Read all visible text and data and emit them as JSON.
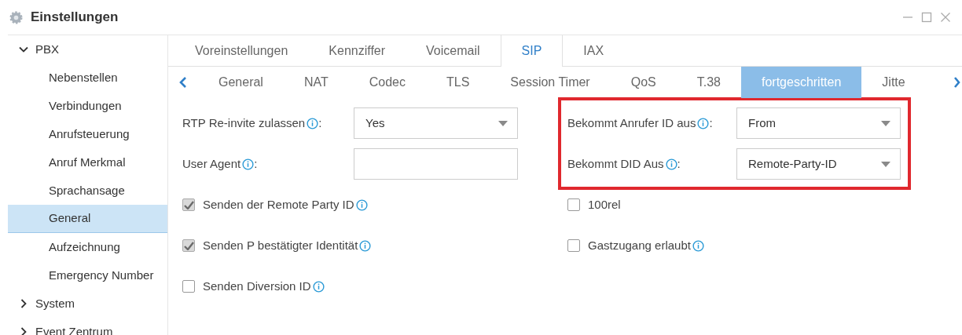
{
  "window": {
    "title": "Einstellungen"
  },
  "sidebar": {
    "items": [
      {
        "label": "PBX",
        "expanded": true,
        "children": [
          {
            "label": "Nebenstellen",
            "selected": false
          },
          {
            "label": "Verbindungen",
            "selected": false
          },
          {
            "label": "Anrufsteuerung",
            "selected": false
          },
          {
            "label": "Anruf Merkmal",
            "selected": false
          },
          {
            "label": "Sprachansage",
            "selected": false
          },
          {
            "label": "General",
            "selected": true
          },
          {
            "label": "Aufzeichnung",
            "selected": false
          },
          {
            "label": "Emergency Number",
            "selected": false
          }
        ]
      },
      {
        "label": "System",
        "expanded": false
      },
      {
        "label": "Event Zentrum",
        "expanded": false
      }
    ]
  },
  "tabs": [
    {
      "label": "Voreinstellungen",
      "selected": false
    },
    {
      "label": "Kennziffer",
      "selected": false
    },
    {
      "label": "Voicemail",
      "selected": false
    },
    {
      "label": "SIP",
      "selected": true
    },
    {
      "label": "IAX",
      "selected": false
    }
  ],
  "subtabs": [
    {
      "label": "General",
      "selected": false
    },
    {
      "label": "NAT",
      "selected": false
    },
    {
      "label": "Codec",
      "selected": false
    },
    {
      "label": "TLS",
      "selected": false
    },
    {
      "label": "Session Timer",
      "selected": false
    },
    {
      "label": "QoS",
      "selected": false
    },
    {
      "label": "T.38",
      "selected": false
    },
    {
      "label": "fortgeschritten",
      "selected": true
    },
    {
      "label": "Jitte",
      "selected": false
    }
  ],
  "form": {
    "left": [
      {
        "kind": "select",
        "label": "RTP Re-invite zulassen",
        "suffix": ":",
        "value": "Yes"
      },
      {
        "kind": "input",
        "label": "User Agent",
        "suffix": ":"
      },
      {
        "kind": "checkbox",
        "label": "Senden der Remote Party ID",
        "checked": true
      },
      {
        "kind": "checkbox",
        "label": "Senden P bestätigter Identität",
        "checked": true
      },
      {
        "kind": "checkbox",
        "label": "Senden Diversion ID",
        "checked": false
      }
    ],
    "right_highlighted": true,
    "right": [
      {
        "kind": "select",
        "label": "Bekommt Anrufer ID aus",
        "suffix": ":",
        "value": "From"
      },
      {
        "kind": "select",
        "label": "Bekommt DID Aus",
        "suffix": ":",
        "value": "Remote-Party-ID"
      },
      {
        "kind": "checkbox",
        "label": "100rel",
        "checked": false,
        "info": false
      },
      {
        "kind": "checkbox",
        "label": "Gastzugang erlaubt",
        "checked": false
      }
    ]
  }
}
